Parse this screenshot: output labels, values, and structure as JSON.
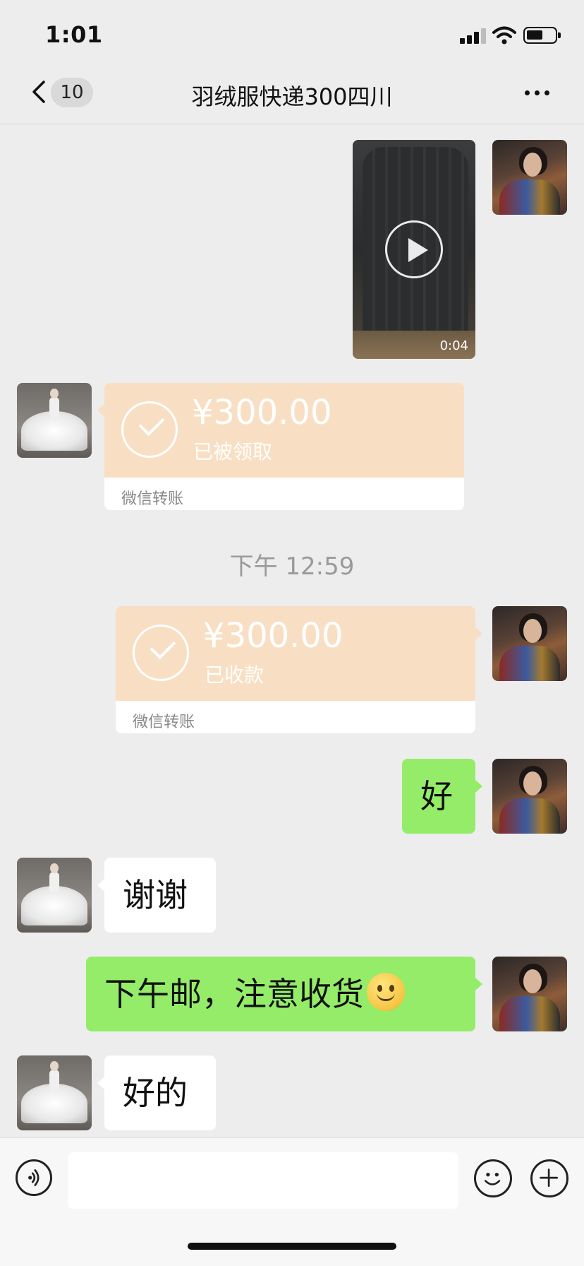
{
  "status_bar": {
    "time": "1:01",
    "icons": [
      "signal-icon",
      "wifi-icon",
      "battery-icon"
    ]
  },
  "nav": {
    "back_icon": "chevron-left-icon",
    "unread_count": "10",
    "title": "羽绒服快递300四川",
    "more_icon": "more-dots-icon"
  },
  "colors": {
    "background": "#ededed",
    "bubble_me": "#95ec69",
    "bubble_them": "#ffffff",
    "transfer": "#f8dfc3",
    "time_text": "#9a9a9a"
  },
  "messages": {
    "video": {
      "duration": "0:04",
      "icon": "play-icon"
    },
    "transfer_received": {
      "amount": "¥300.00",
      "status": "已被领取",
      "footer": "微信转账"
    },
    "time_separator": "下午 12:59",
    "transfer_collected": {
      "amount": "¥300.00",
      "status": "已收款",
      "footer": "微信转账"
    },
    "text_1": "好",
    "text_2": "谢谢",
    "text_3": "下午邮，注意收货",
    "text_4": "好的"
  },
  "input_bar": {
    "voice_icon": "voice-icon",
    "emoji_icon": "emoji-icon",
    "plus_icon": "plus-icon",
    "placeholder": ""
  }
}
